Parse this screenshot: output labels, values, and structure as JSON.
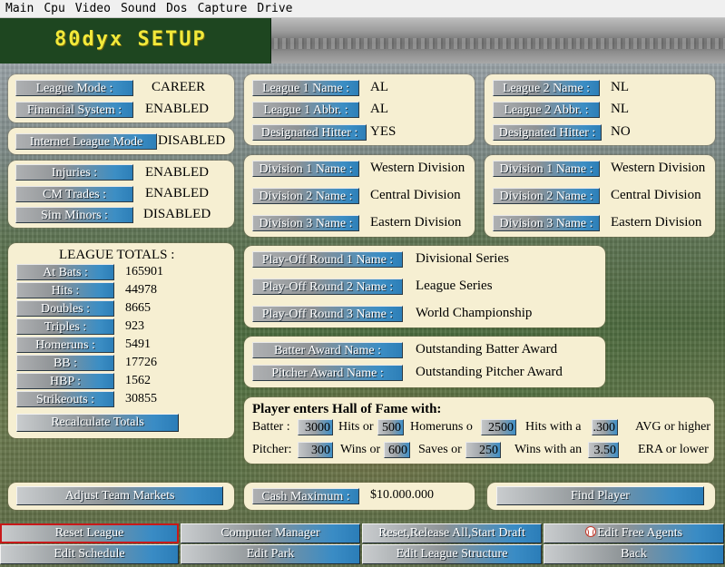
{
  "menu": [
    "Main",
    "Cpu",
    "Video",
    "Sound",
    "Dos",
    "Capture",
    "Drive"
  ],
  "app_title": "80dyx SETUP",
  "colors": {
    "panel_bg": "#f6efd2",
    "title_bg": "#1e4620",
    "title_text": "#f2e93a",
    "button_blue": "#2d7fb8",
    "selected_outline": "#c8191a"
  },
  "league_mode": {
    "mode_label": "League Mode :",
    "mode_value": "CAREER",
    "financial_label": "Financial System :",
    "financial_value": "ENABLED"
  },
  "internet": {
    "label": "Internet League Mode",
    "value": "DISABLED"
  },
  "options": {
    "injuries_label": "Injuries :",
    "injuries_value": "ENABLED",
    "cm_trades_label": "CM Trades :",
    "cm_trades_value": "ENABLED",
    "sim_minors_label": "Sim Minors :",
    "sim_minors_value": "DISABLED"
  },
  "totals": {
    "title": "LEAGUE TOTALS :",
    "rows": [
      {
        "label": "At Bats :",
        "value": "165901"
      },
      {
        "label": "Hits :",
        "value": "44978"
      },
      {
        "label": "Doubles :",
        "value": "8665"
      },
      {
        "label": "Triples :",
        "value": "923"
      },
      {
        "label": "Homeruns :",
        "value": "5491"
      },
      {
        "label": "BB :",
        "value": "17726"
      },
      {
        "label": "HBP :",
        "value": "1562"
      },
      {
        "label": "Strikeouts :",
        "value": "30855"
      }
    ],
    "recalc_label": "Recalculate Totals"
  },
  "league1": {
    "name_label": "League 1 Name :",
    "name_value": "AL",
    "abbr_label": "League 1 Abbr. :",
    "abbr_value": "AL",
    "dh_label": "Designated Hitter :",
    "dh_value": "YES"
  },
  "league2": {
    "name_label": "League 2 Name :",
    "name_value": "NL",
    "abbr_label": "League 2 Abbr. :",
    "abbr_value": "NL",
    "dh_label": "Designated Hitter :",
    "dh_value": "NO"
  },
  "divisions1": [
    {
      "label": "Division 1 Name :",
      "value": "Western Division"
    },
    {
      "label": "Division 2 Name :",
      "value": "Central Division"
    },
    {
      "label": "Division 3 Name :",
      "value": "Eastern Division"
    }
  ],
  "divisions2": [
    {
      "label": "Division 1 Name :",
      "value": "Western Division"
    },
    {
      "label": "Division 2 Name :",
      "value": "Central Division"
    },
    {
      "label": "Division 3 Name :",
      "value": "Eastern Division"
    }
  ],
  "playoffs": [
    {
      "label": "Play-Off Round 1 Name :",
      "value": "Divisional Series"
    },
    {
      "label": "Play-Off Round 2 Name :",
      "value": "League Series"
    },
    {
      "label": "Play-Off Round 3 Name :",
      "value": "World Championship"
    }
  ],
  "awards": {
    "batter_label": "Batter Award Name :",
    "batter_value": "Outstanding Batter Award",
    "pitcher_label": "Pitcher Award Name :",
    "pitcher_value": "Outstanding Pitcher Award"
  },
  "hof": {
    "title": "Player enters Hall of Fame with:",
    "batter": {
      "label": "Batter :",
      "hits": "3000",
      "hits_text": "Hits or",
      "homeruns": "500",
      "homeruns_text": "Homeruns o",
      "avg_hits": "2500",
      "avg_hits_text": "Hits with a",
      "avg": ".300",
      "avg_text": "AVG or higher"
    },
    "pitcher": {
      "label": "Pitcher:",
      "wins": "300",
      "wins_text": "Wins or",
      "saves": "600",
      "saves_text": "Saves or",
      "era_wins": "250",
      "era_wins_text": "Wins with an",
      "era": "3.50",
      "era_text": "ERA or lower"
    }
  },
  "cash": {
    "label": "Cash Maximum :",
    "value": "$10.000.000"
  },
  "buttons": {
    "adjust_markets": "Adjust Team Markets",
    "find_player": "Find Player",
    "reset_league": "Reset League",
    "computer_manager": "Computer Manager",
    "reset_release": "Reset,Release All,Start Draft",
    "edit_free_agents": "Edit Free Agents",
    "edit_schedule": "Edit Schedule",
    "edit_park": "Edit Park",
    "edit_structure": "Edit League Structure",
    "back": "Back"
  }
}
